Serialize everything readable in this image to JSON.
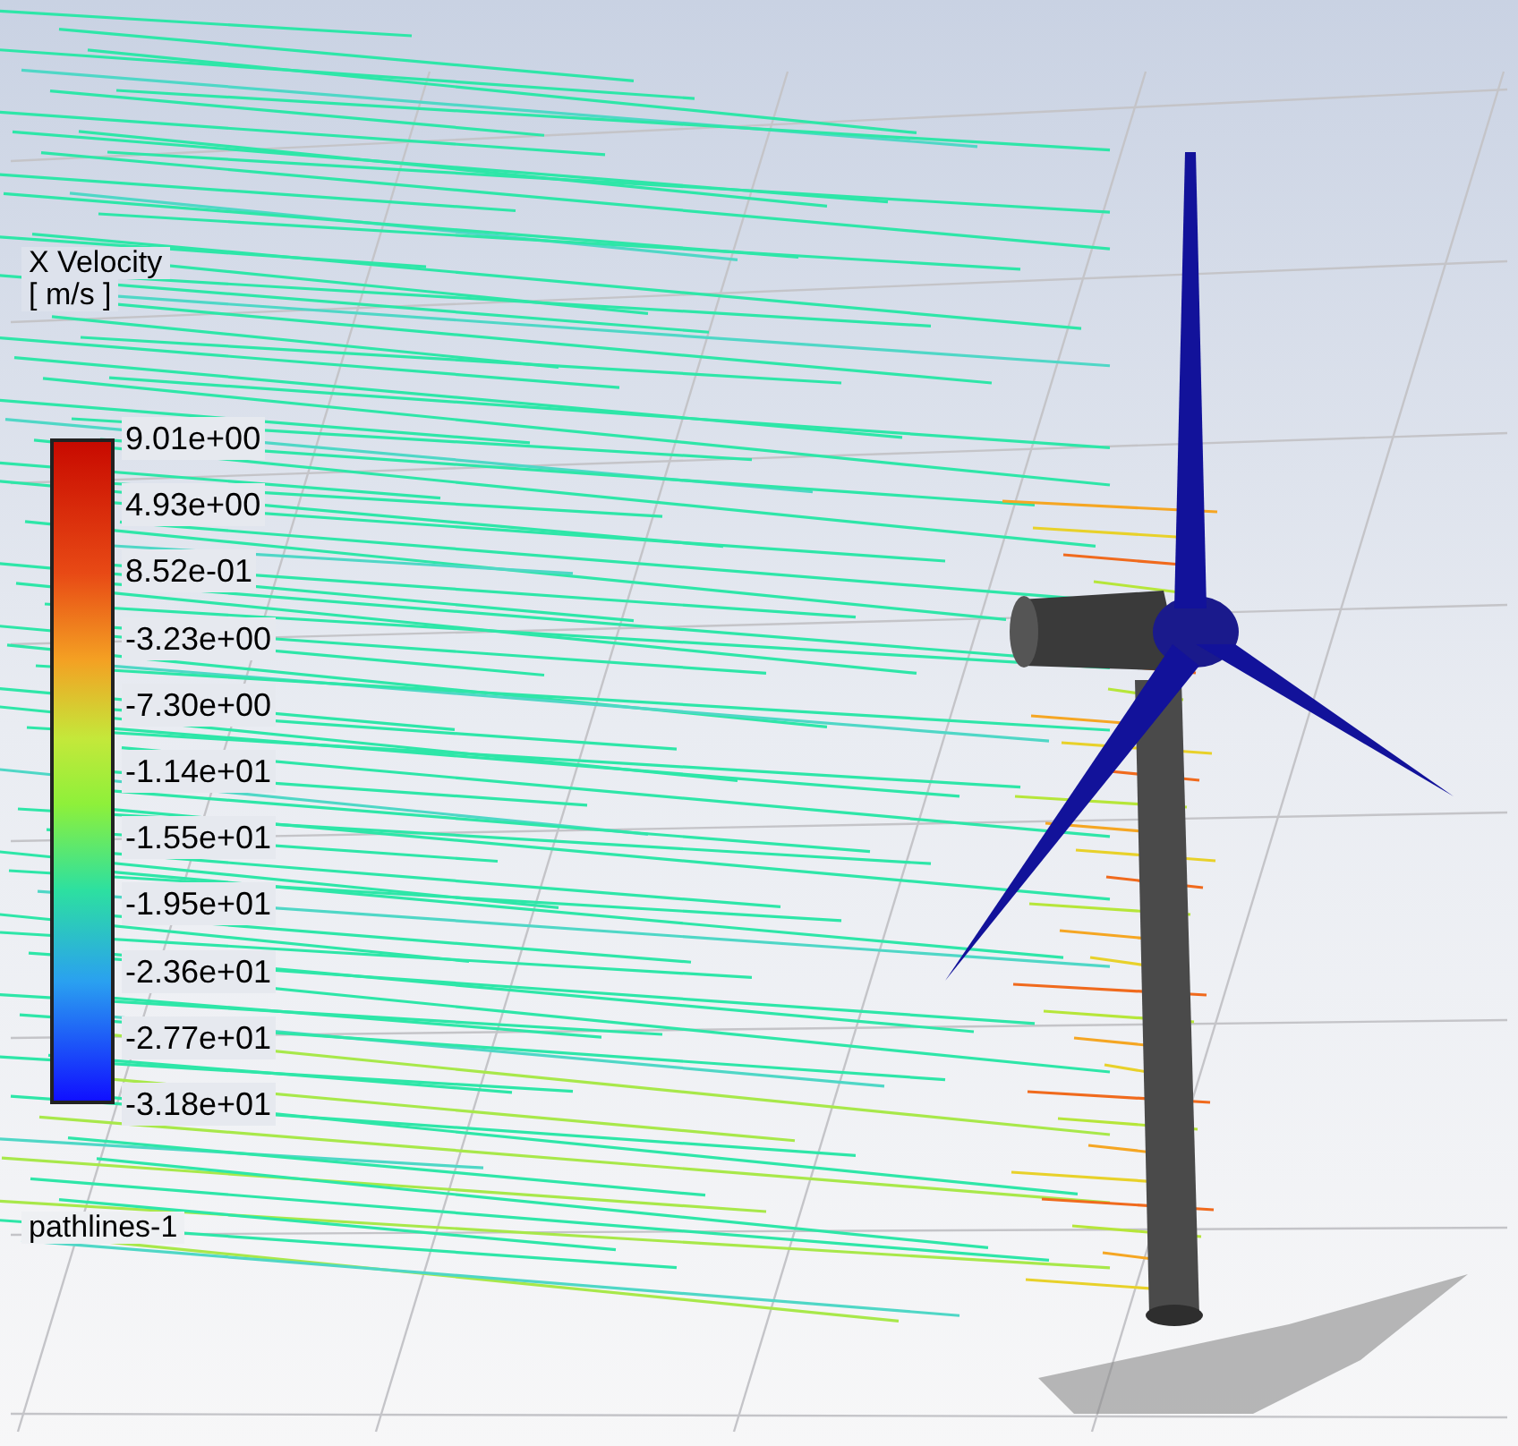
{
  "legend": {
    "title": "X Velocity",
    "unit": "[ m/s ]",
    "labels": [
      "9.01e+00",
      "4.93e+00",
      "8.52e-01",
      "-3.23e+00",
      "-7.30e+00",
      "-1.14e+01",
      "-1.55e+01",
      "-1.95e+01",
      "-2.36e+01",
      "-2.77e+01",
      "-3.18e+01"
    ]
  },
  "scene_label": "pathlines-1"
}
